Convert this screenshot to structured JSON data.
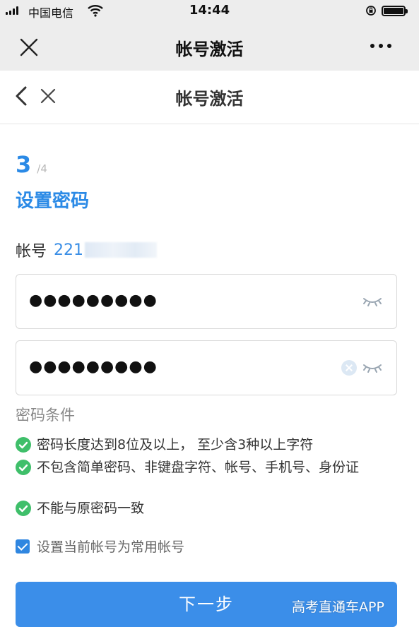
{
  "status_bar": {
    "carrier": "中国电信",
    "time": "14:44"
  },
  "wechat_nav": {
    "title": "帐号激活"
  },
  "page_header": {
    "title": "帐号激活"
  },
  "step": {
    "current": "3",
    "total": "/4"
  },
  "section_title": "设置密码",
  "account": {
    "label": "帐号",
    "value_visible": "221"
  },
  "password_fields": [
    {
      "value": "●●●●●●●●●"
    },
    {
      "value": "●●●●●●●●●"
    }
  ],
  "conditions": {
    "title": "密码条件",
    "items": [
      "密码长度达到8位及以上， 至少含3种以上字符",
      "不包含简单密码、非键盘字符、帐号、手机号、身份证",
      "不能与原密码一致"
    ]
  },
  "remember": {
    "checked": true,
    "label": "设置当前帐号为常用帐号"
  },
  "next_button": "下一步",
  "watermark": "高考直通车APP",
  "colors": {
    "accent": "#2b8ae6",
    "button": "#3b8ee9",
    "success": "#3fbf6a",
    "nav_bg": "#ededed"
  }
}
